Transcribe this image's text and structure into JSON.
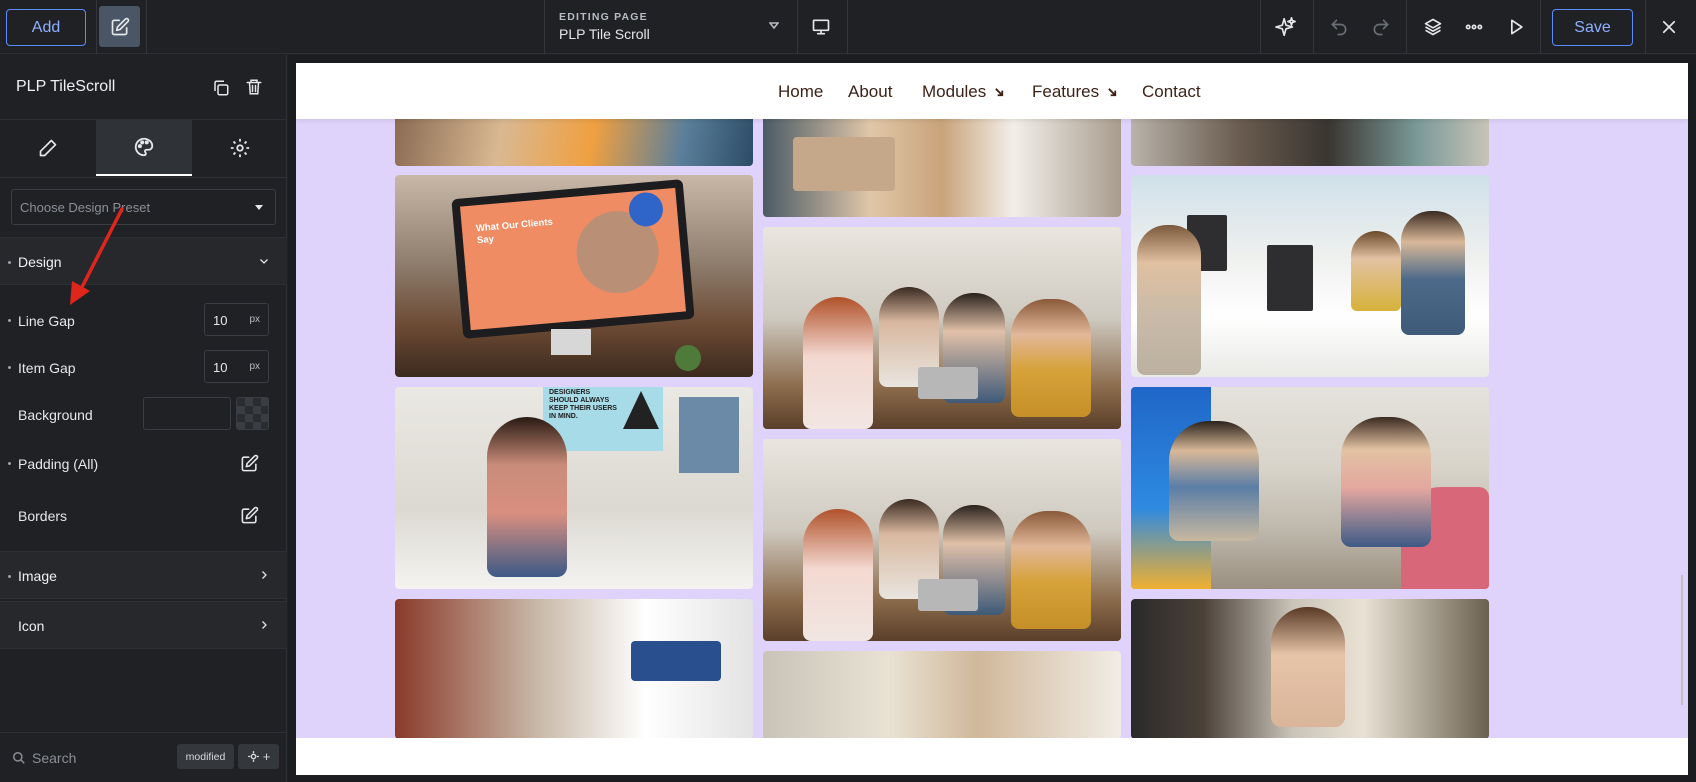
{
  "topbar": {
    "add_label": "Add",
    "editing_small": "EDITING PAGE",
    "editing_page": "PLP Tile Scroll",
    "save_label": "Save"
  },
  "panel": {
    "title": "PLP TileScroll",
    "preset_placeholder": "Choose Design Preset",
    "design_section": "Design",
    "rows": {
      "line_gap": {
        "label": "Line Gap",
        "value": "10",
        "unit": "px"
      },
      "item_gap": {
        "label": "Item Gap",
        "value": "10",
        "unit": "px"
      },
      "background": {
        "label": "Background"
      },
      "padding": {
        "label": "Padding (All)"
      },
      "borders": {
        "label": "Borders"
      }
    },
    "image_section": "Image",
    "icon_section": "Icon",
    "search_placeholder": "Search",
    "modified_badge": "modified"
  },
  "site": {
    "nav": [
      {
        "label": "Home",
        "dropdown": false
      },
      {
        "label": "About",
        "dropdown": false
      },
      {
        "label": "Modules",
        "dropdown": true
      },
      {
        "label": "Features",
        "dropdown": true
      },
      {
        "label": "Contact",
        "dropdown": false
      }
    ],
    "tile_texts": {
      "clients": "What Our Clients Say",
      "designers": "DESIGNERS SHOULD ALWAYS KEEP THEIR USERS IN MIND."
    }
  },
  "colors": {
    "accent": "#5b8cff",
    "gallery_bg": "#dfd3fb",
    "arrow": "#e0261c",
    "nav_text": "#3d2216"
  }
}
